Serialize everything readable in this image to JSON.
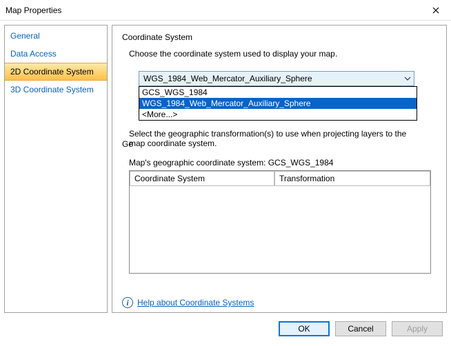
{
  "window": {
    "title": "Map Properties"
  },
  "sidebar": {
    "items": [
      {
        "label": "General"
      },
      {
        "label": "Data Access"
      },
      {
        "label": "2D Coordinate System"
      },
      {
        "label": "3D Coordinate System"
      }
    ]
  },
  "main": {
    "group_title": "Coordinate System",
    "choose_text": "Choose the coordinate system used to display your map.",
    "dropdown": {
      "selected": "WGS_1984_Web_Mercator_Auxiliary_Sphere",
      "options": [
        "GCS_WGS_1984",
        "WGS_1984_Web_Mercator_Auxiliary_Sphere",
        "<More...>"
      ]
    },
    "geo_trans_partial": "Ge",
    "select_trans_text": "Select the geographic transformation(s) to use when projecting layers to the map coordinate system.",
    "gc_label": "Map's geographic coordinate system: GCS_WGS_1984",
    "table": {
      "col1": "Coordinate System",
      "col2": "Transformation"
    },
    "help_link": "Help about Coordinate Systems"
  },
  "footer": {
    "ok": "OK",
    "cancel": "Cancel",
    "apply": "Apply"
  }
}
